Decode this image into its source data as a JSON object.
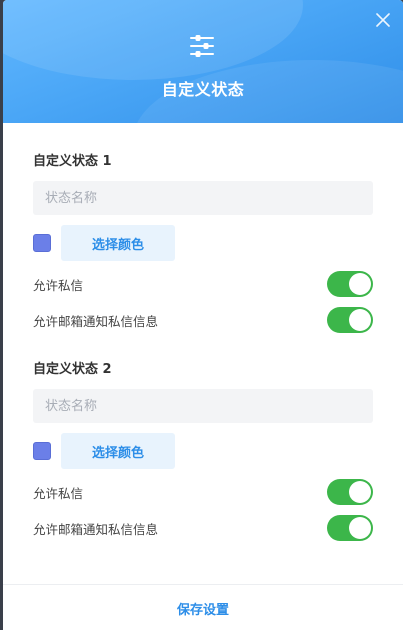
{
  "header": {
    "title": "自定义状态",
    "icon": "sliders-icon",
    "close_icon": "close-icon"
  },
  "statuses": [
    {
      "title": "自定义状态 1",
      "name_placeholder": "状态名称",
      "name_value": "",
      "swatch_color": "#6b7fe8",
      "color_button_label": "选择颜色",
      "toggles": [
        {
          "label": "允许私信",
          "on": true
        },
        {
          "label": "允许邮箱通知私信信息",
          "on": true
        }
      ]
    },
    {
      "title": "自定义状态 2",
      "name_placeholder": "状态名称",
      "name_value": "",
      "swatch_color": "#6b7fe8",
      "color_button_label": "选择颜色",
      "toggles": [
        {
          "label": "允许私信",
          "on": true
        },
        {
          "label": "允许邮箱通知私信信息",
          "on": true
        }
      ]
    }
  ],
  "footer": {
    "save_label": "保存设置"
  },
  "colors": {
    "accent": "#2d8ee8",
    "toggle_on": "#3cb64a",
    "header_gradient_start": "#62b8ff"
  }
}
